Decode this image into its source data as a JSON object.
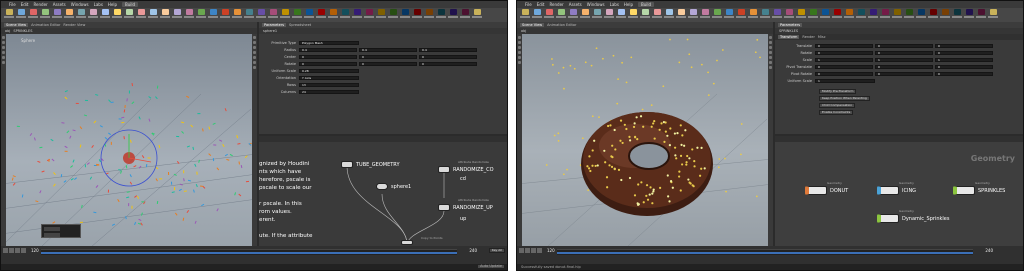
{
  "app": {
    "menu": [
      "File",
      "Edit",
      "Render",
      "Assets",
      "Windows",
      "Labs",
      "Help"
    ],
    "desktop": "Build"
  },
  "left_window": {
    "viewport_label": "Sphere",
    "param_node_name": "sphere1",
    "param_type_label": "Polygon Mesh",
    "param_rows": [
      {
        "label": "Primitive Type",
        "values": [
          "Polygon Mesh"
        ]
      },
      {
        "label": "Radius",
        "values": [
          "0.4",
          "0.4",
          "0.4"
        ]
      },
      {
        "label": "Center",
        "values": [
          "0",
          "0",
          "0"
        ]
      },
      {
        "label": "Rotate",
        "values": [
          "0",
          "0",
          "0"
        ]
      },
      {
        "label": "Uniform Scale",
        "values": [
          "0.28"
        ]
      },
      {
        "label": "Orientation",
        "values": [
          "Y Axis"
        ]
      },
      {
        "label": "Rows",
        "values": [
          "13"
        ]
      },
      {
        "label": "Columns",
        "values": [
          "24"
        ]
      }
    ],
    "help_lines": [
      "gnized by Houdini",
      "nts which have",
      "herefore, pscale is",
      "pscale to scale our",
      "",
      "r pscale. In this",
      "rom values.",
      "erent.",
      "",
      "ute. If the attribute"
    ],
    "nodes": [
      {
        "label": "TUBE_GEOMETRY",
        "color": "#d9d9d9"
      },
      {
        "label": "sphere1",
        "color": "#d9d9d9"
      },
      {
        "label": "RANDOMIZE_CO",
        "sub": "Attribute Randomize",
        "color": "#d9d9d9"
      },
      {
        "label": "cd",
        "color": "#d9d9d9"
      },
      {
        "label": "RANDOMIZE_UP",
        "sub": "Attribute Randomize",
        "color": "#d9d9d9"
      },
      {
        "label": "up",
        "color": "#d9d9d9"
      },
      {
        "label": "Copy to Points",
        "color": "#d9d9d9"
      }
    ],
    "frame_current": "120",
    "frame_end": "240",
    "status": "Auto Update"
  },
  "right_window": {
    "param_node_name": "SPRINKLES",
    "param_tab": "Transform",
    "param_rows": [
      {
        "label": "Translate",
        "values": [
          "0",
          "0",
          "0"
        ]
      },
      {
        "label": "Rotate",
        "values": [
          "0",
          "0",
          "0"
        ]
      },
      {
        "label": "Scale",
        "values": [
          "1",
          "1",
          "1"
        ]
      },
      {
        "label": "Pivot Translate",
        "values": [
          "0",
          "0",
          "0"
        ]
      },
      {
        "label": "Pivot Rotate",
        "values": [
          "0",
          "0",
          "0"
        ]
      },
      {
        "label": "Uniform Scale",
        "values": [
          "1"
        ]
      }
    ],
    "param_buttons": [
      "Modify Pre-Transform",
      "Keep Position When Parenting",
      "Child Compensation",
      "Enable Constraints"
    ],
    "net_title": "Geometry",
    "nodes": [
      {
        "label": "DONUT",
        "sub": "Geometry",
        "color": "#e07a3a"
      },
      {
        "label": "ICING",
        "sub": "Geometry",
        "color": "#4aa3d8"
      },
      {
        "label": "SPRINKLES",
        "sub": "Geometry",
        "color": "#8cc63f"
      },
      {
        "label": "Dynamic_Sprinkles",
        "sub": "Geometry",
        "color": "#8cc63f"
      }
    ],
    "frame_current": "120",
    "frame_end": "240",
    "status": "Successfully saved donut-final.hip"
  }
}
